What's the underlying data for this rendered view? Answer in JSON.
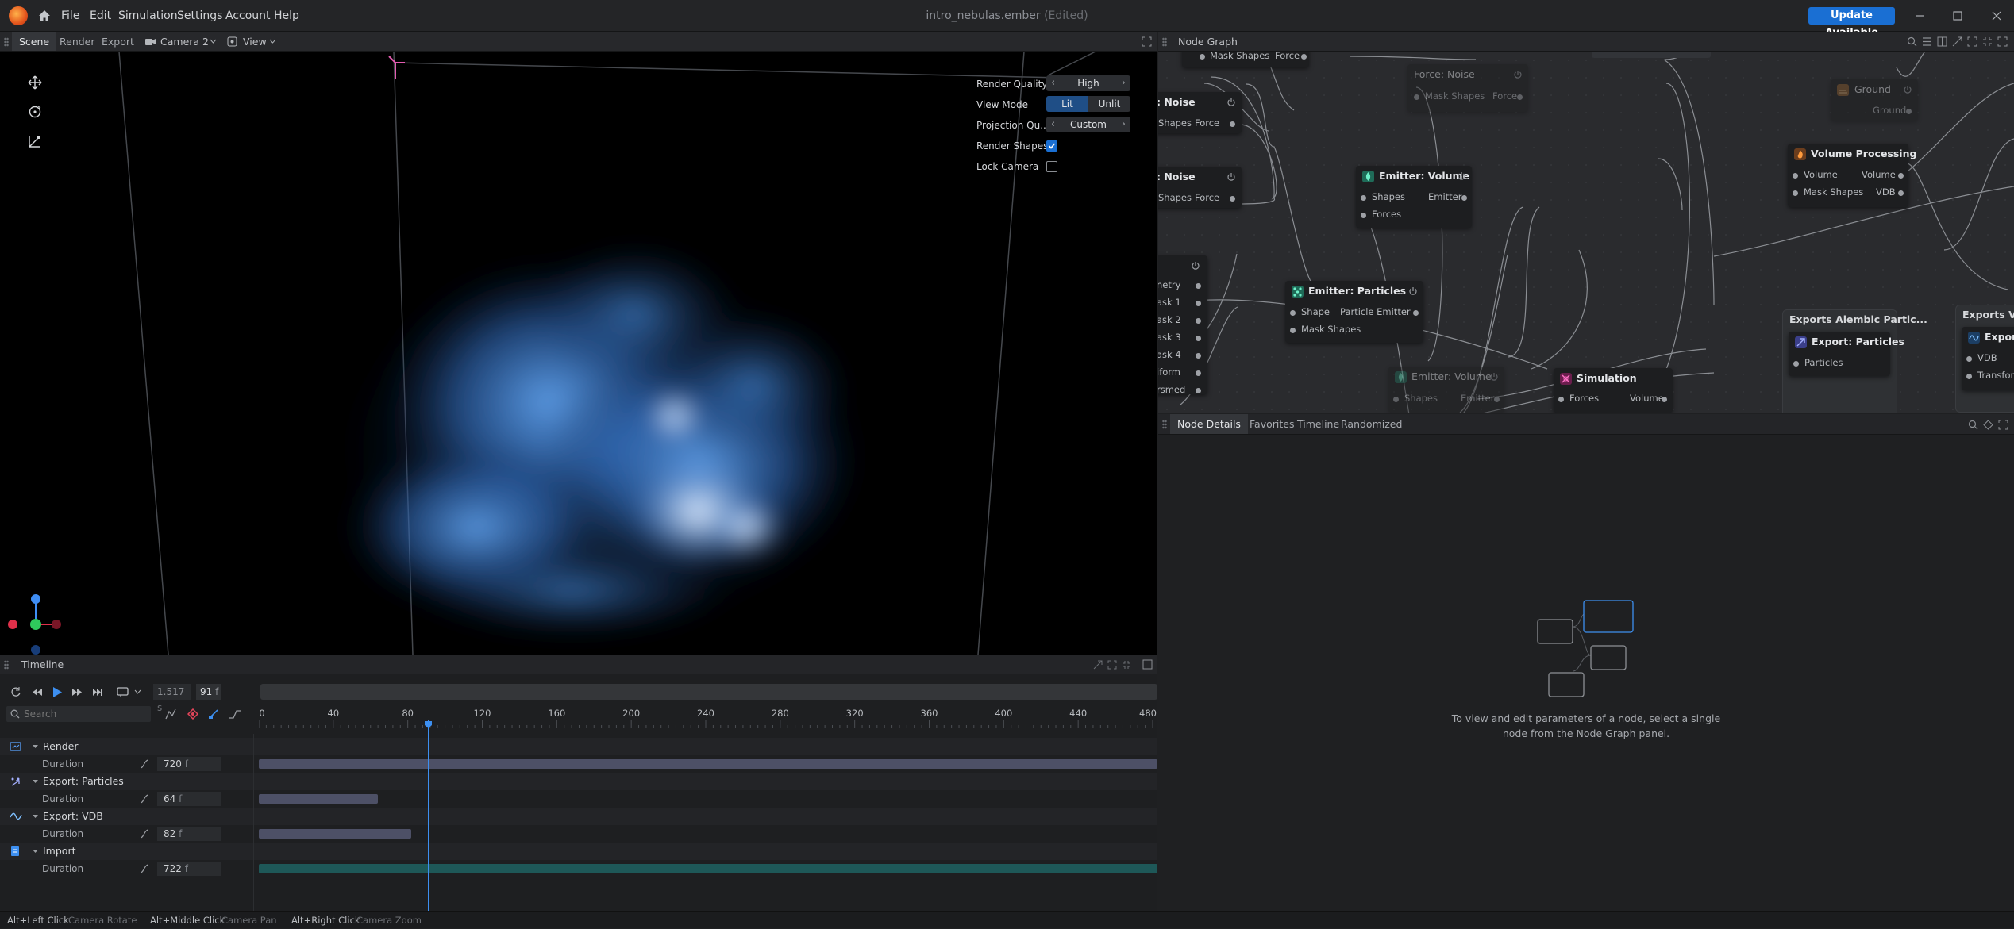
{
  "app": {
    "menus": [
      "File",
      "Edit",
      "Simulation",
      "Settings",
      "Account",
      "Help"
    ],
    "doc_name": "intro_nebulas.ember",
    "doc_state": "(Edited)",
    "update_label": "Update Available"
  },
  "viewport_panel": {
    "tabs": [
      "Scene",
      "Render",
      "Export"
    ],
    "camera": "Camera 2",
    "view": "View",
    "props": {
      "render_quality_label": "Render Quality",
      "render_quality_value": "High",
      "view_mode_label": "View Mode",
      "view_mode_options": [
        "Lit",
        "Unlit"
      ],
      "view_mode_selected": "Lit",
      "projection_label": "Projection Qu...",
      "projection_value": "Custom",
      "render_shapes_label": "Render Shapes",
      "render_shapes_checked": true,
      "lock_camera_label": "Lock Camera",
      "lock_camera_checked": false
    }
  },
  "timeline": {
    "title": "Timeline",
    "time_seconds": "1.517",
    "time_unit_s": "s",
    "frame": "91",
    "frame_unit": "f",
    "search_placeholder": "Search",
    "ruler": [
      "0",
      "40",
      "80",
      "120",
      "160",
      "200",
      "240",
      "280",
      "320",
      "360",
      "400",
      "440",
      "480"
    ],
    "ruler_max": 480,
    "playhead_frame": 91,
    "tracks": [
      {
        "name": "Render",
        "param": "Duration",
        "value": "720",
        "unit": "f",
        "frames": 720,
        "color": "#4d5066"
      },
      {
        "name": "Export: Particles",
        "param": "Duration",
        "value": "64",
        "unit": "f",
        "frames": 64,
        "color": "#4d5066"
      },
      {
        "name": "Export: VDB",
        "param": "Duration",
        "value": "82",
        "unit": "f",
        "frames": 82,
        "color": "#4d5066"
      },
      {
        "name": "Import",
        "param": "Duration",
        "value": "722",
        "unit": "f",
        "frames": 722,
        "color": "#1e5858"
      }
    ]
  },
  "node_graph": {
    "title": "Node Graph",
    "nodes": {
      "noise1": {
        "title": ": Noise",
        "in": "Shapes",
        "out": "Force"
      },
      "noise2": {
        "title": ": Noise",
        "in": "Shapes",
        "out": "Force"
      },
      "top_stub": {
        "in": "Mask Shapes",
        "out": "Force"
      },
      "force_noise": {
        "title": "Force: Noise",
        "in": "Mask Shapes",
        "out": "Force"
      },
      "ground": {
        "title": "Ground",
        "out": "Ground"
      },
      "emitter_volume": {
        "title": "Emitter: Volume",
        "in1": "Shapes",
        "out": "Emitter",
        "in2": "Forces"
      },
      "volume_processing": {
        "title": "Volume Processing",
        "in1": "Volume",
        "out1": "Volume",
        "in2": "Mask Shapes",
        "out2": "VDB"
      },
      "emitter_particles": {
        "title": "Emitter: Particles",
        "in1": "Shape",
        "out": "Particle Emitter",
        "in2": "Mask Shapes"
      },
      "left_partial": {
        "ports": [
          "netry",
          "ask 1",
          "ask 2",
          "ask 3",
          "ask 4",
          "iform",
          "rsmed"
        ]
      },
      "emitter_volume2": {
        "title": "Emitter: Volume",
        "in": "Shapes",
        "out": "Emitter"
      },
      "simulation": {
        "title": "Simulation",
        "in": "Forces",
        "out": "Volume"
      },
      "export_particles": {
        "group": "Exports Alembic Partic...",
        "title": "Export: Particles",
        "in": "Particles"
      },
      "export_vdb": {
        "group": "Exports VDB",
        "title": "Export:",
        "in1": "VDB",
        "in2": "Transfor"
      }
    }
  },
  "details_panel": {
    "tabs": [
      "Node Details",
      "Favorites",
      "Timeline",
      "Randomized"
    ],
    "empty_line1": "To view and edit parameters of a node, select a single",
    "empty_line2": "node from the Node Graph panel."
  },
  "status": [
    {
      "key": "Alt+Left Click",
      "action": "Camera Rotate"
    },
    {
      "key": "Alt+Middle Click",
      "action": "Camera Pan"
    },
    {
      "key": "Alt+Right Click",
      "action": "Camera Zoom"
    }
  ],
  "colors": {
    "accent": "#1a6fd3",
    "smoke": "#3f7fc9",
    "node_bg": "#1d1e20"
  }
}
